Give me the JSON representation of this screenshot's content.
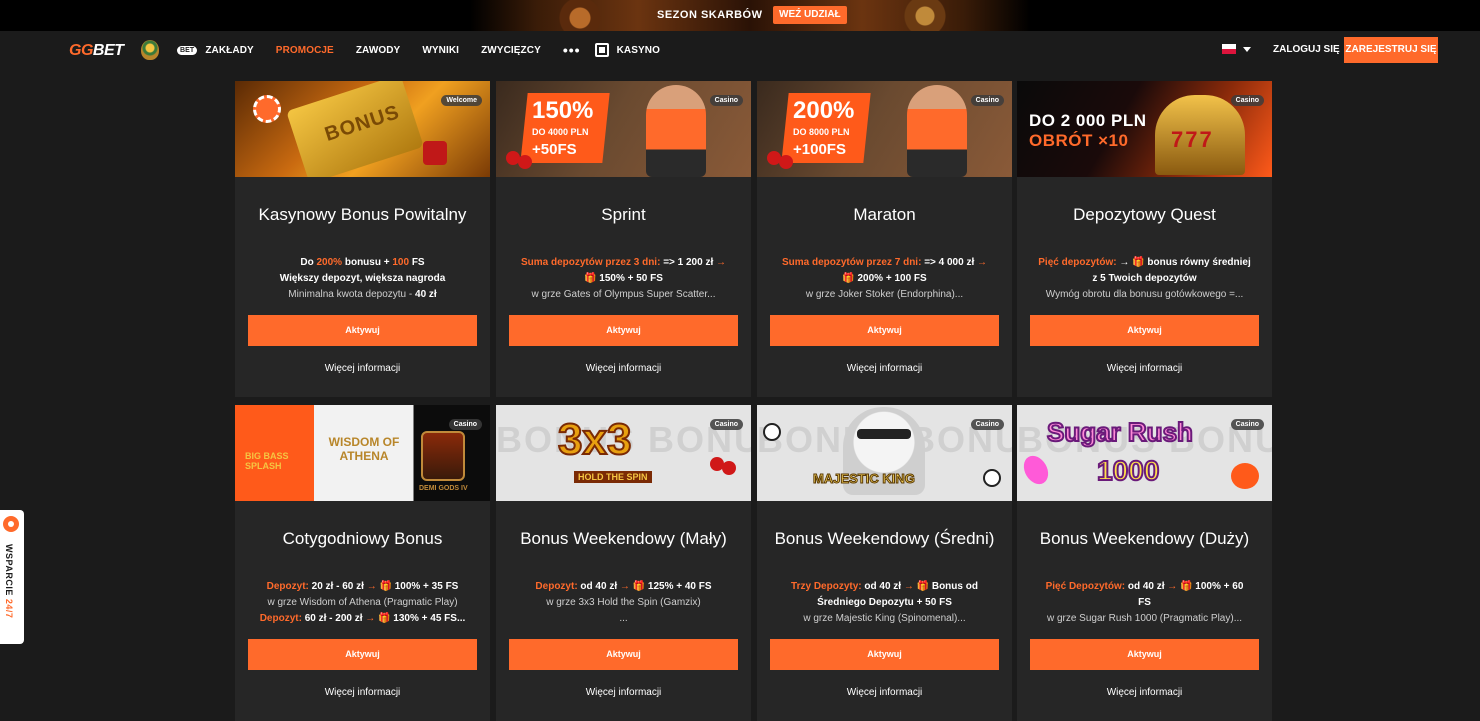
{
  "promo_banner": {
    "text": "SEZON SKARBÓW",
    "cta": "WEŹ UDZIAŁ"
  },
  "header": {
    "logo": {
      "gg": "GG",
      "bet": "BET"
    },
    "nav": {
      "bet_badge": "BET",
      "items": [
        "ZAKŁADY",
        "PROMOCJE",
        "ZAWODY",
        "WYNIKI",
        "ZWYCIĘZCY",
        "KASYNO"
      ],
      "active": "PROMOCJE",
      "more": "•••"
    },
    "login": "ZALOGUJ SIĘ",
    "register": "ZAREJESTRUJ SIĘ"
  },
  "cards": [
    {
      "tag": "Welcome",
      "image_text": {
        "main": "BONUS"
      },
      "title": "Kasynowy Bonus Powitalny",
      "line1": {
        "a": "Do ",
        "b": "200%",
        "c": " bonusu + ",
        "d": "100",
        "e": " FS"
      },
      "line2": "Większy depozyt, większa nagroda",
      "line3": {
        "a": "Minimalna kwota depozytu - ",
        "b": "40 zł"
      },
      "button": "Aktywuj",
      "more": "Więcej informacji"
    },
    {
      "tag": "Casino",
      "image_text": {
        "big": "150%",
        "small": "DO 4000 PLN",
        "fs": "+50FS"
      },
      "title": "Sprint",
      "line1": {
        "a": "Suma depozytów przez 3 dni:",
        "b": " => 1 200 zł ",
        "c": "→"
      },
      "line2": "🎁 150% + 50 FS",
      "line3": "w grze Gates of Olympus Super Scatter...",
      "button": "Aktywuj",
      "more": "Więcej informacji"
    },
    {
      "tag": "Casino",
      "image_text": {
        "big": "200%",
        "small": "DO 8000 PLN",
        "fs": "+100FS"
      },
      "title": "Maraton",
      "line1": {
        "a": "Suma depozytów przez 7 dni:",
        "b": " => 4 000 zł ",
        "c": "→"
      },
      "line2": "🎁 200% + 100 FS",
      "line3": "w grze Joker Stoker (Endorphina)...",
      "button": "Aktywuj",
      "more": "Więcej informacji"
    },
    {
      "tag": "Casino",
      "image_text": {
        "l1": "DO 2 000 PLN",
        "l2": "OBRÓT ×10",
        "slot": "777"
      },
      "title": "Depozytowy Quest",
      "line1": {
        "a": "Pięć depozytów:",
        "b": " → 🎁 bonus równy średniej"
      },
      "line2": "z 5 Twoich depozytów",
      "line3": "Wymóg obrotu dla bonusu gotówkowego =...",
      "button": "Aktywuj",
      "more": "Więcej informacji"
    },
    {
      "tag": "Casino",
      "image_text": {
        "bb": "BIG BASS SPLASH",
        "wa": "WISDOM OF ATHENA",
        "dg": "DEMI GODS IV"
      },
      "title": "Cotygodniowy Bonus",
      "line1": {
        "a": "Depozyt:",
        "b": " 20 zł - 60 zł ",
        "c": "→",
        "d": " 🎁 100% + 35 FS"
      },
      "line2": "w grze Wisdom of Athena (Pragmatic Play)",
      "line3": {
        "a": "Depozyt:",
        "b": " 60 zł - 200 zł ",
        "c": "→",
        "d": " 🎁 130% + 45 FS..."
      },
      "button": "Aktywuj",
      "more": "Więcej informacji"
    },
    {
      "tag": "Casino",
      "image_text": {
        "bg": "BONUS BONUS",
        "main": "3x3",
        "sub": "HOLD THE SPIN"
      },
      "title": "Bonus Weekendowy (Mały)",
      "line1": {
        "a": "Depozyt:",
        "b": " od 40 zł ",
        "c": "→",
        "d": " 🎁 125% + 40 FS"
      },
      "line2": "w grze 3x3 Hold the Spin (Gamzix)",
      "line3": "...",
      "button": "Aktywuj",
      "more": "Więcej informacji"
    },
    {
      "tag": "Casino",
      "image_text": {
        "bg": "BONUS BONUS",
        "main": "MAJESTIC KING"
      },
      "title": "Bonus Weekendowy (Średni)",
      "line1": {
        "a": "Trzy Depozyty:",
        "b": " od 40 zł ",
        "c": "→",
        "d": " 🎁 Bonus od"
      },
      "line2": "Średniego Depozytu + 50 FS",
      "line3": "w grze Majestic King (Spinomenal)...",
      "button": "Aktywuj",
      "more": "Więcej informacji"
    },
    {
      "tag": "Casino",
      "image_text": {
        "bg": "BONUS BONUS",
        "l1": "Sugar Rush",
        "l2": "1000"
      },
      "title": "Bonus Weekendowy (Duży)",
      "line1": {
        "a": "Pięć Depozytów:",
        "b": " od 40 zł ",
        "c": "→",
        "d": " 🎁 100% + 60"
      },
      "line2": "FS",
      "line3": "w grze Sugar Rush 1000 (Pragmatic Play)...",
      "button": "Aktywuj",
      "more": "Więcej informacji"
    }
  ],
  "support": {
    "a": "WSPARCIE ",
    "b": "24/7"
  },
  "colors": {
    "accent": "#ff6a2b",
    "background": "#1b1b1b",
    "card": "#262626"
  }
}
